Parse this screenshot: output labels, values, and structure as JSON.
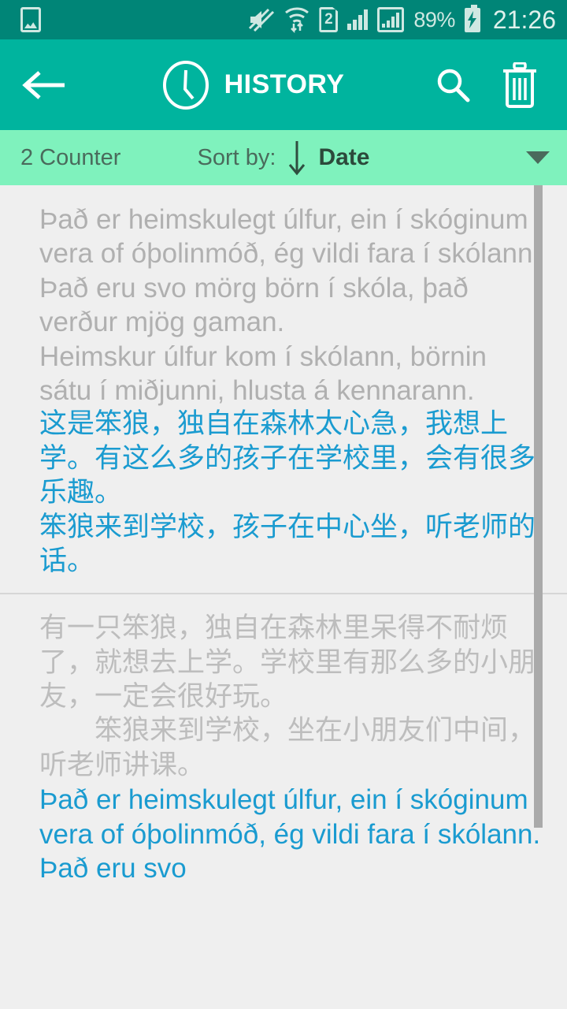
{
  "status_bar": {
    "background_color": "#008577",
    "left_icons": [
      "gallery-icon"
    ],
    "right_icons": [
      "mute-icon",
      "wifi-transfer-icon",
      "sim-2-icon",
      "signal-bars-icon",
      "signal-bars-boxed-icon"
    ],
    "sim_label": "2",
    "battery_percent": "89%",
    "battery_state": "charging",
    "time": "21:26"
  },
  "app_bar": {
    "background_color": "#00b49e",
    "title": "HISTORY",
    "back_icon": "arrow-left-icon",
    "title_icon": "clock-icon",
    "actions": [
      {
        "name": "search",
        "icon": "search-icon"
      },
      {
        "name": "delete",
        "icon": "trash-icon"
      }
    ]
  },
  "sort_bar": {
    "background_color": "#7ff2bd",
    "counter_label": "2 Counter",
    "sort_by_label": "Sort by:",
    "sort_direction_icon": "arrow-down-icon",
    "sort_value": "Date",
    "dropdown_icon": "caret-down-icon"
  },
  "history": {
    "items": [
      {
        "source_text": "Það er heimskulegt úlfur, ein í skóginum vera of óþolinmóð, ég vildi fara í skólann. Það eru svo mörg börn í skóla, það verður mjög gaman.\nHeimskur úlfur kom í skólann, börnin sátu í miðjunni, hlusta á kennarann.",
        "source_lang": "latin",
        "target_text": "这是笨狼，独自在森林太心急，我想上学。有这么多的孩子在学校里，会有很多乐趣。\n笨狼来到学校，孩子在中心坐，听老师的话。",
        "target_lang": "cjk"
      },
      {
        "source_text": "有一只笨狼，独自在森林里呆得不耐烦了，就想去上学。学校里有那么多的小朋友，一定会很好玩。\n　　笨狼来到学校，坐在小朋友们中间，听老师讲课。",
        "source_lang": "cjk",
        "target_text": "Það er heimskulegt úlfur, ein í skóginum vera of óþolinmóð, ég vildi fara í skólann. Það eru svo",
        "target_lang": "latin"
      }
    ]
  },
  "colors": {
    "accent_teal": "#00b49e",
    "status_teal": "#008577",
    "mint": "#7ff2bd",
    "translation_blue": "#1a9bd0",
    "source_gray": "#b0b0b0",
    "page_bg": "#efefef"
  }
}
